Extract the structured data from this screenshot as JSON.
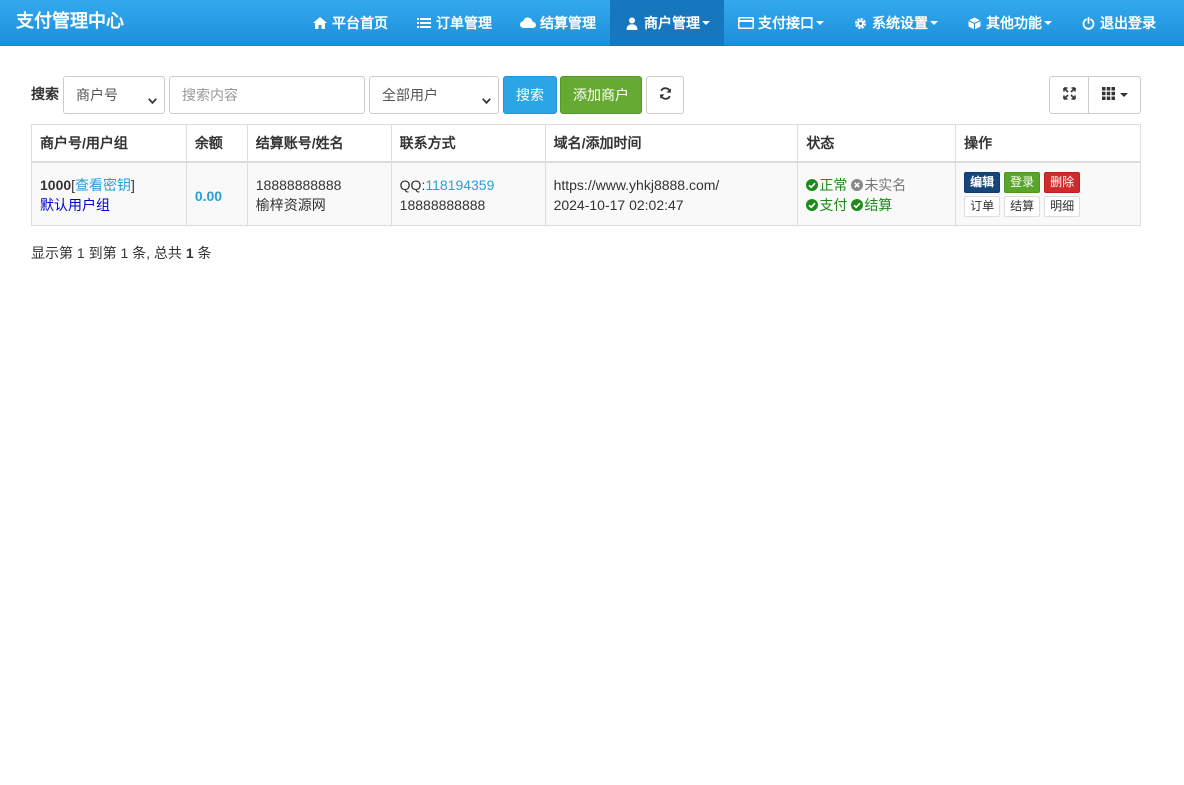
{
  "brand": "支付管理中心",
  "nav": {
    "home": "平台首页",
    "orders": "订单管理",
    "settle": "结算管理",
    "merchants": "商户管理",
    "payapi": "支付接口",
    "settings": "系统设置",
    "other": "其他功能",
    "logout": "退出登录"
  },
  "search": {
    "label": "搜索",
    "field_selected": "商户号",
    "placeholder": "搜索内容",
    "user_filter_selected": "全部用户",
    "search_button": "搜索",
    "add_button": "添加商户"
  },
  "table": {
    "headers": [
      "商户号/用户组",
      "余额",
      "结算账号/姓名",
      "联系方式",
      "域名/添加时间",
      "状态",
      "操作"
    ],
    "rows": [
      {
        "uid": "1000",
        "view_key": "查看密钥",
        "group": "默认用户组",
        "balance": "0.00",
        "account": "18888888888",
        "name": "榆梓资源网",
        "qq_prefix": "QQ:",
        "qq": "118194359",
        "phone": "18888888888",
        "domain": "https://www.yhkj8888.com/",
        "added": "2024-10-17 02:02:47",
        "status_normal": "正常",
        "status_unverified": "未实名",
        "status_pay": "支付",
        "status_settle": "结算",
        "actions": {
          "edit": "编辑",
          "login": "登录",
          "delete": "删除",
          "orders": "订单",
          "settle": "结算",
          "detail": "明细"
        }
      }
    ]
  },
  "pagination": {
    "prefix": "显示第",
    "from": "1",
    "to_text": "到第",
    "to": "1",
    "mid": "条, 总共",
    "total": "1",
    "suffix": "条"
  },
  "colors": {
    "navbar": "#1c8fd9",
    "nav_active": "#1677bf",
    "primary": "#2ca5e6",
    "success": "#66aa33",
    "danger": "#d12a2a",
    "edit": "#16457a",
    "ok_text": "#1e8a1e"
  },
  "icons": {
    "home": "home-icon",
    "orders": "list-icon",
    "settle": "cloud-icon",
    "merchants": "user-icon",
    "payapi": "credit-card-icon",
    "settings": "gear-icon",
    "other": "cube-icon",
    "logout": "power-icon",
    "refresh": "refresh-icon",
    "fullscreen": "fullscreen-icon",
    "columns": "grid-icon"
  }
}
